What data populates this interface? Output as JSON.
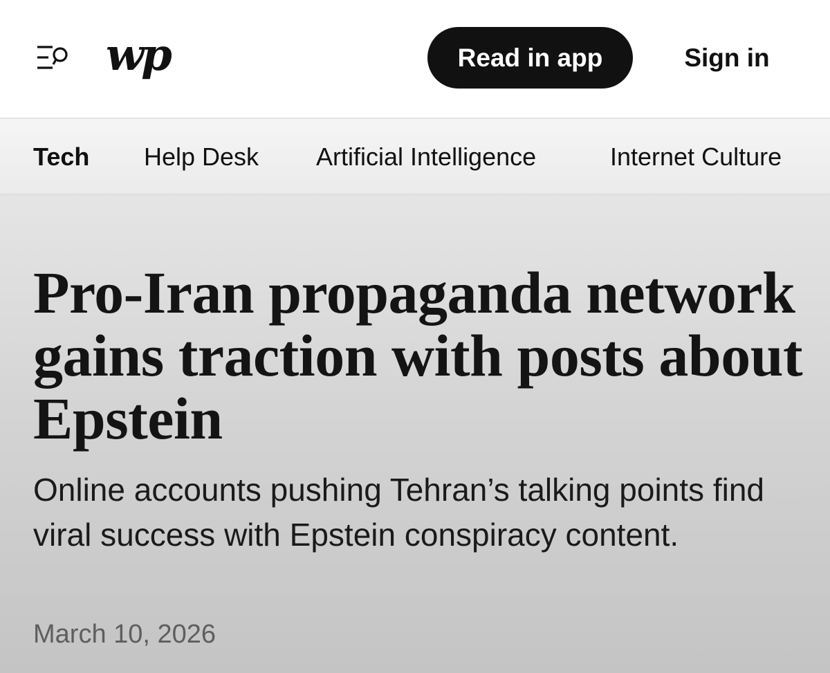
{
  "header": {
    "menu_icon": "menu-search-icon",
    "logo_text": "wp",
    "read_in_app_label": "Read in app",
    "sign_in_label": "Sign in"
  },
  "section_nav": {
    "items": [
      {
        "label": "Tech",
        "active": true
      },
      {
        "label": "Help Desk",
        "active": false
      },
      {
        "label": "Artificial Intelligence",
        "active": false
      },
      {
        "label": "Internet Culture",
        "active": false
      }
    ]
  },
  "article": {
    "headline": "Pro-Iran propaganda network gains traction with posts about Epstein",
    "deck": "Online accounts pushing Tehran’s talking points find viral success with Epstein conspiracy content.",
    "date": "March 10, 2026"
  },
  "colors": {
    "button_bg": "#111111",
    "button_text": "#ffffff",
    "date_text": "#5e5e5e"
  }
}
